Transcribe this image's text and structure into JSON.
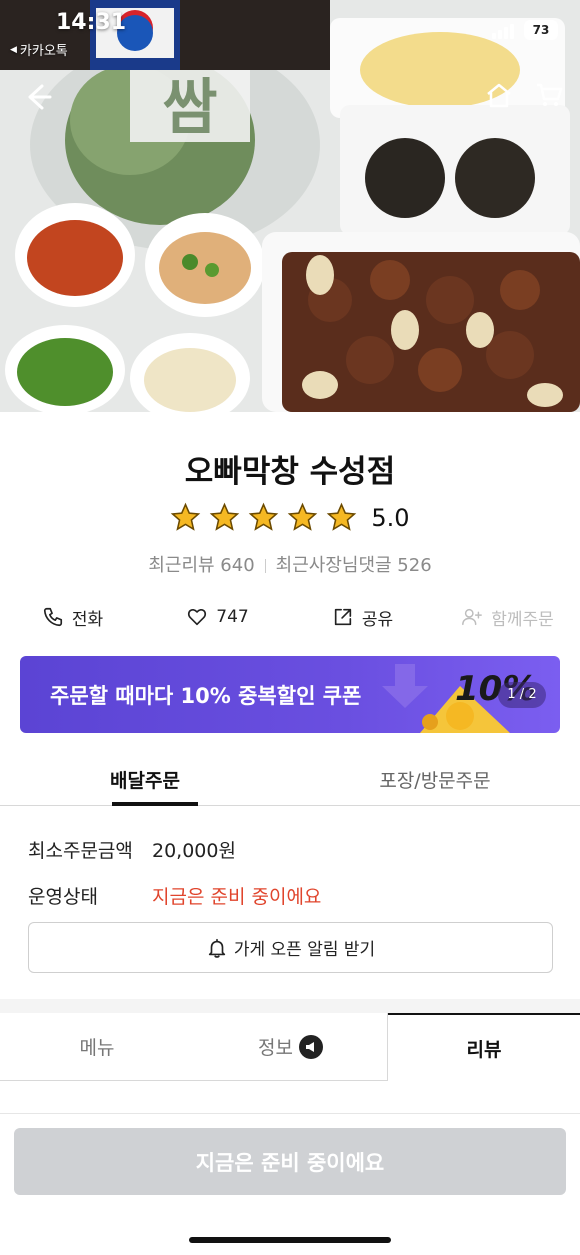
{
  "status_bar": {
    "time": "14:31",
    "back_app": "카카오톡",
    "battery": "73"
  },
  "hero": {
    "photo_sign_text": "쌈",
    "bottle_label": "Pepsi"
  },
  "store": {
    "name": "오빠막창 수성점",
    "rating": "5.0",
    "rating_stars": 5,
    "recent_reviews": "최근리뷰 640",
    "owner_replies": "최근사장님댓글 526"
  },
  "actions": {
    "call": "전화",
    "likes": "747",
    "share": "공유",
    "group_order": "함께주문"
  },
  "coupon": {
    "text": "주문할 때마다 10% 중복할인 쿠폰",
    "art_text": "10%",
    "page": "1 / 2"
  },
  "order_tabs": {
    "delivery": "배달주문",
    "pickup": "포장/방문주문"
  },
  "info": {
    "min_order_label": "최소주문금액",
    "min_order_value": "20,000원",
    "status_label": "운영상태",
    "status_value": "지금은 준비 중이에요",
    "notify_button": "가게 오픈 알림 받기"
  },
  "content_tabs": {
    "menu": "메뉴",
    "info": "정보",
    "review": "리뷰"
  },
  "cta": {
    "label": "지금은 준비 중이에요"
  },
  "colors": {
    "coupon_bg": "#5b44d4",
    "status_red": "#e0452d",
    "cta_disabled": "#cfd1d4",
    "star": "#f5b823"
  }
}
